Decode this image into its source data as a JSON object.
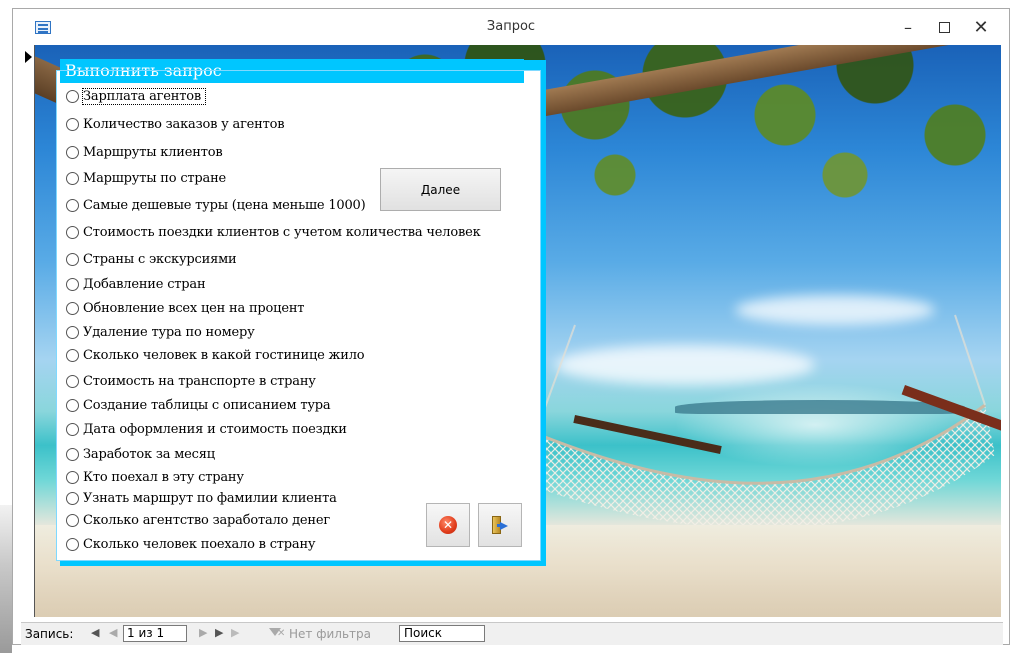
{
  "window": {
    "title": "Запрос",
    "minimize_glyph": "–",
    "close_glyph": "✕"
  },
  "form": {
    "header": "Выполнить запрос",
    "next_button": "Далее",
    "options": [
      {
        "label": "Зарплата агентов",
        "selected": false,
        "focused": true
      },
      {
        "label": "Количество заказов у агентов",
        "selected": false
      },
      {
        "label": "Маршруты клиентов",
        "selected": false
      },
      {
        "label": "Маршруты по стране",
        "selected": false
      },
      {
        "label": "Самые дешевые туры (цена меньше 1000)",
        "selected": false
      },
      {
        "label": "Стоимость поездки клиентов с учетом количества человек",
        "selected": false
      },
      {
        "label": "Страны с экскурсиями",
        "selected": false
      },
      {
        "label": "Добавление стран",
        "selected": false
      },
      {
        "label": "Обновление всех цен на процент",
        "selected": false
      },
      {
        "label": "Удаление тура по номеру",
        "selected": false
      },
      {
        "label": "Сколько человек в какой гостинице жило",
        "selected": false
      },
      {
        "label": "Стоимость на транспорте в страну",
        "selected": false
      },
      {
        "label": "Создание таблицы с описанием тура",
        "selected": false
      },
      {
        "label": "Дата оформления и стоимость поездки",
        "selected": false
      },
      {
        "label": "Заработок за месяц",
        "selected": false
      },
      {
        "label": "Кто поехал в эту страну",
        "selected": false
      },
      {
        "label": "Узнать маршрут по фамилии клиента",
        "selected": false
      },
      {
        "label": "Сколько агентство заработало денег",
        "selected": false
      },
      {
        "label": "Сколько человек поехало в страну",
        "selected": false
      }
    ],
    "icons": {
      "cancel": "cancel-icon",
      "exit": "exit-door-icon"
    }
  },
  "navigation": {
    "label": "Запись:",
    "first_glyph": "◀",
    "prev_glyph": "◀",
    "position": "1 из 1",
    "next_glyph": "▶",
    "last_glyph": "▶",
    "new_glyph": "▶",
    "filter": "Нет фильтра",
    "search": "Поиск"
  }
}
